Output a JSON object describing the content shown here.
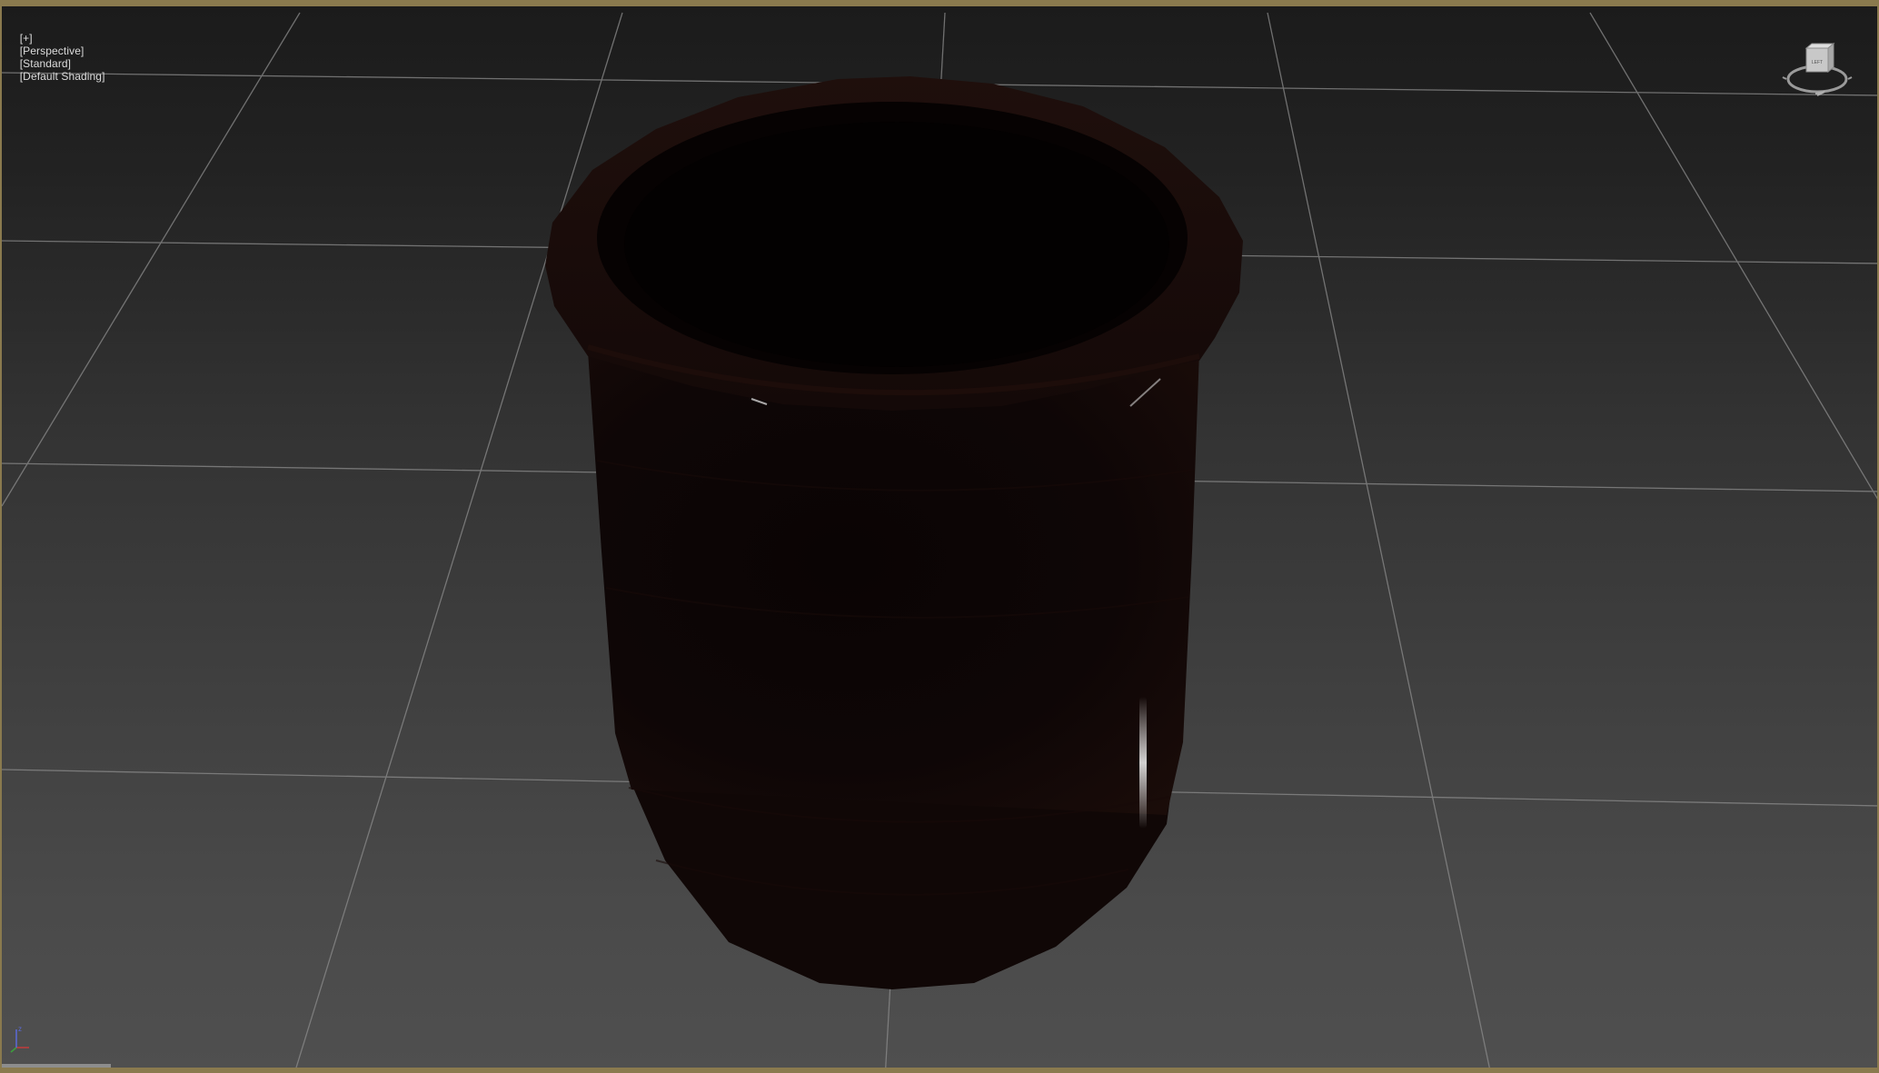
{
  "viewport": {
    "label_parts": [
      "[+]",
      "[Perspective]",
      "[Standard]",
      "[Default Shading]"
    ],
    "border_color": "#8a7a4e",
    "background_top": "#1b1b1b",
    "background_bottom": "#4f4f4f"
  },
  "viewcube": {
    "face_label": "LEFT",
    "icon": "viewcube-icon"
  },
  "axis_tripod": {
    "z_label": "z",
    "icon": "axis-tripod-icon"
  },
  "scene": {
    "object": "bucket-model",
    "object_color": "#120807",
    "grid_color": "#8c8c8c"
  }
}
